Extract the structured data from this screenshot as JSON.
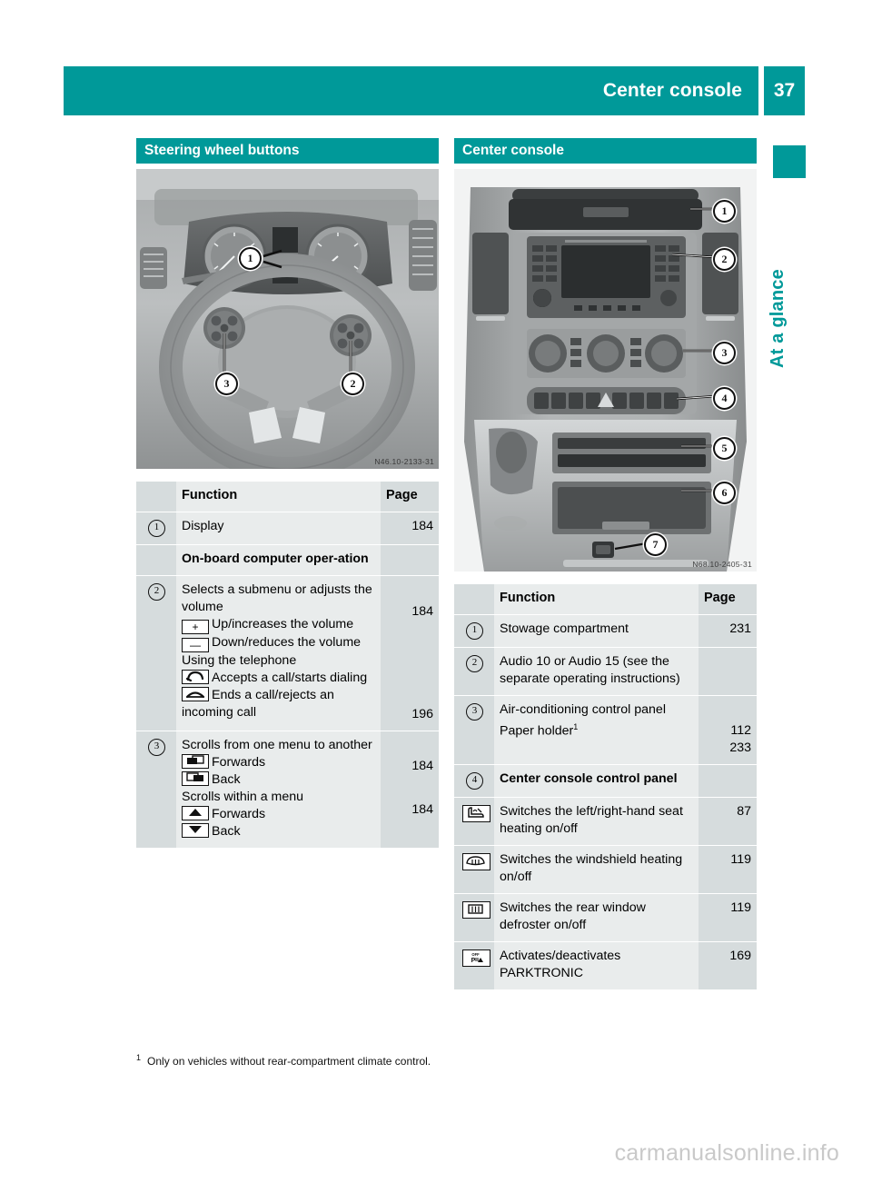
{
  "header": {
    "title": "Center console",
    "page_number": "37"
  },
  "side_tab": {
    "label": "At a glance"
  },
  "left_column": {
    "section_title": "Steering wheel buttons",
    "figure": {
      "caption": "N46.10-2133-31",
      "callouts": [
        "1",
        "2",
        "3"
      ]
    },
    "table": {
      "col_function": "Function",
      "col_page": "Page",
      "rows": [
        {
          "num": "1",
          "lines": [
            {
              "text": "Display"
            }
          ],
          "page": "184"
        },
        {
          "num": "",
          "bold": true,
          "lines": [
            {
              "text": "On-board computer oper-ation"
            }
          ],
          "page": ""
        },
        {
          "num": "2",
          "lines": [
            {
              "text": "Selects a submenu or adjusts the volume",
              "page": "184"
            },
            {
              "icon": "plus-key",
              "text": "Up/increases the volume"
            },
            {
              "icon": "minus-key",
              "text": "Down/reduces the volume"
            },
            {
              "text": "Using the telephone",
              "page": "196"
            },
            {
              "icon": "accept-call-key",
              "text": "Accepts a call/starts dialing"
            },
            {
              "icon": "end-call-key",
              "text": "Ends a call/rejects an incoming call"
            }
          ],
          "pages": [
            "184",
            "196"
          ]
        },
        {
          "num": "3",
          "lines": [
            {
              "text": "Scrolls from one menu to another",
              "page": "184"
            },
            {
              "icon": "menu-forward-key",
              "text": "Forwards"
            },
            {
              "icon": "menu-back-key",
              "text": "Back"
            },
            {
              "text": "Scrolls within a menu",
              "page": "184"
            },
            {
              "icon": "up-arrow-key",
              "text": "Forwards"
            },
            {
              "icon": "down-arrow-key",
              "text": "Back"
            }
          ],
          "pages": [
            "184",
            "184"
          ]
        }
      ]
    }
  },
  "right_column": {
    "section_title": "Center console",
    "figure": {
      "caption": "N68.10-2405-31",
      "callouts": [
        "1",
        "2",
        "3",
        "4",
        "5",
        "6",
        "7"
      ]
    },
    "table": {
      "col_function": "Function",
      "col_page": "Page",
      "rows": [
        {
          "num": "1",
          "text": "Stowage compartment",
          "page": "231"
        },
        {
          "num": "2",
          "text": "Audio 10 or Audio 15 (see the separate operating instructions)",
          "page": ""
        },
        {
          "num": "3",
          "lines": [
            {
              "text": "Air-conditioning control panel",
              "page": "112"
            },
            {
              "text": "Paper holder",
              "footnote": "1",
              "page": "233"
            }
          ]
        },
        {
          "num": "4",
          "bold": true,
          "text": "Center console control panel",
          "page": ""
        },
        {
          "icon": "seat-heating-icon",
          "text": "Switches the left/right-hand seat heating on/off",
          "page": "87"
        },
        {
          "icon": "windshield-heating-icon",
          "text": "Switches the windshield heating on/off",
          "page": "119"
        },
        {
          "icon": "rear-defroster-icon",
          "text": "Switches the rear window defroster on/off",
          "page": "119"
        },
        {
          "icon": "parktronic-icon",
          "text": "Activates/deactivates PARKTRONIC",
          "page": "169"
        }
      ]
    }
  },
  "footnote": {
    "mark": "1",
    "text": "Only on vehicles without rear-compartment climate control."
  },
  "watermark": "carmanualsonline.info",
  "colors": {
    "teal": "#009999",
    "table_outer": "#d6dcdd",
    "table_inner": "#e9ecec"
  }
}
